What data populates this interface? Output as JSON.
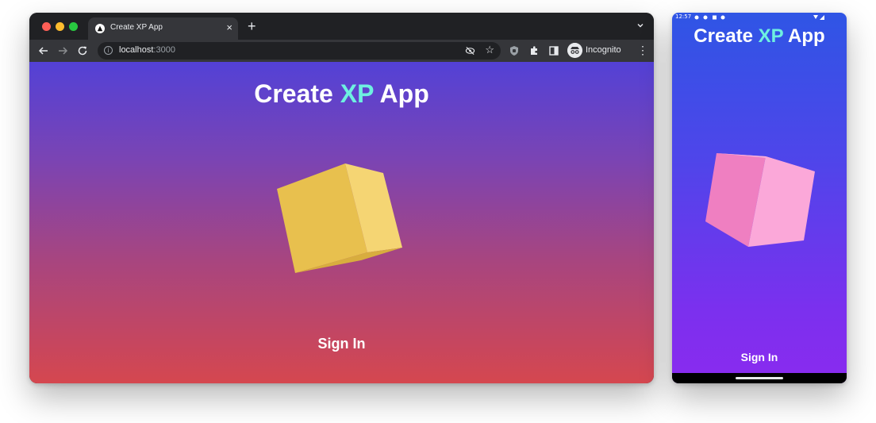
{
  "desktop": {
    "tab": {
      "title": "Create XP App",
      "close": "×"
    },
    "new_tab": "+",
    "address": {
      "host": "localhost",
      "port": ":3000"
    },
    "profile_label": "Incognito",
    "menu": "⋮",
    "app": {
      "title_before": "Create ",
      "title_accent": "XP",
      "title_after": " App",
      "signin_label": "Sign In"
    }
  },
  "mobile": {
    "status_time": "12:57",
    "app": {
      "title_before": "Create ",
      "title_accent": "XP",
      "title_after": " App",
      "signin_label": "Sign In"
    }
  },
  "colors": {
    "accent": "#6ef0e0",
    "desktop_cube": "#e8c04e",
    "mobile_cube": "#f28ccc"
  },
  "icons": {
    "back": "arrow-left-icon",
    "forward": "arrow-right-icon",
    "reload": "reload-icon",
    "info": "info-icon",
    "eye_off": "eye-off-icon",
    "star": "star-icon",
    "extension_shield": "shield-extension-icon",
    "puzzle": "puzzle-icon",
    "sidepanel": "sidepanel-icon",
    "incognito": "incognito-icon"
  }
}
